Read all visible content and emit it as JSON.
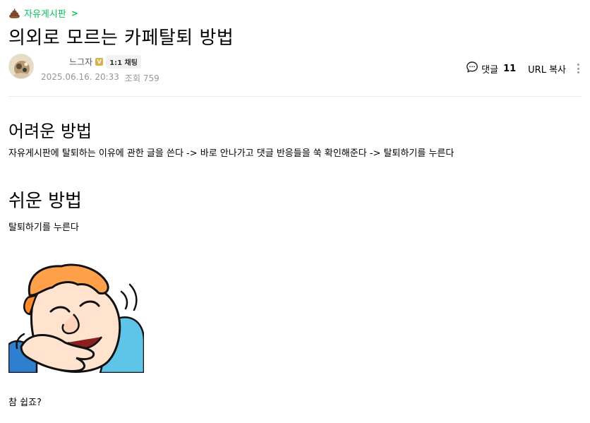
{
  "board": {
    "name": "자유게시판",
    "chevron": ">"
  },
  "post": {
    "title": "의외로 모르는 카페탈퇴 방법",
    "author": {
      "nickname": "느그자",
      "badge_letter": "V",
      "chat_label": "1:1 채팅"
    },
    "date": "2025.06.16. 20:33",
    "views_label": "조회 759"
  },
  "actions": {
    "comment_label": "댓글",
    "comment_count": "11",
    "url_copy_label": "URL 복사"
  },
  "content": {
    "section1_heading": "어려운 방법",
    "section1_text": "자유게시판에 탈퇴하는 이유에 관한 글을 쓴다 -> 바로 안나가고 댓글 반응들을 쑥 확인해준다 -> 탈퇴하기를 누른다",
    "section2_heading": "쉬운 방법",
    "section2_text": "탈퇴하기를 누른다",
    "closing_text": "참 쉽죠?"
  },
  "colors": {
    "accent_green": "#03c75a",
    "meta_gray": "#979797",
    "badge_gold": "#d8b24a"
  },
  "icons": {
    "board": "poop-icon",
    "comment": "speech-bubble-icon",
    "more": "more-vertical-icon"
  }
}
